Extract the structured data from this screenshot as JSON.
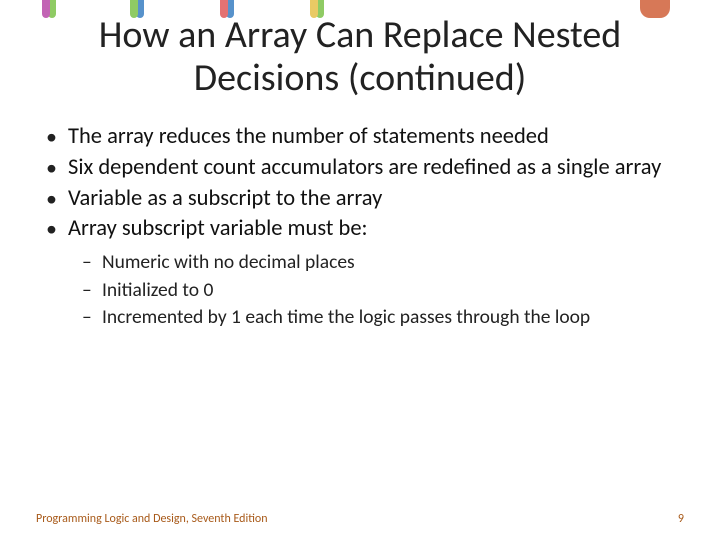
{
  "title": "How an Array Can Replace Nested Decisions (continued)",
  "bullets": [
    {
      "text": "The array reduces the number of statements needed"
    },
    {
      "text": "Six dependent count accumulators are redefined as a single array"
    },
    {
      "text": "Variable as a subscript to the array"
    },
    {
      "text": "Array subscript variable must be:",
      "sub": [
        "Numeric with no decimal places",
        "Initialized to 0",
        "Incremented by 1 each time the logic passes through the loop"
      ]
    }
  ],
  "footer": {
    "left": "Programming Logic and Design, Seventh Edition",
    "right": "9"
  }
}
